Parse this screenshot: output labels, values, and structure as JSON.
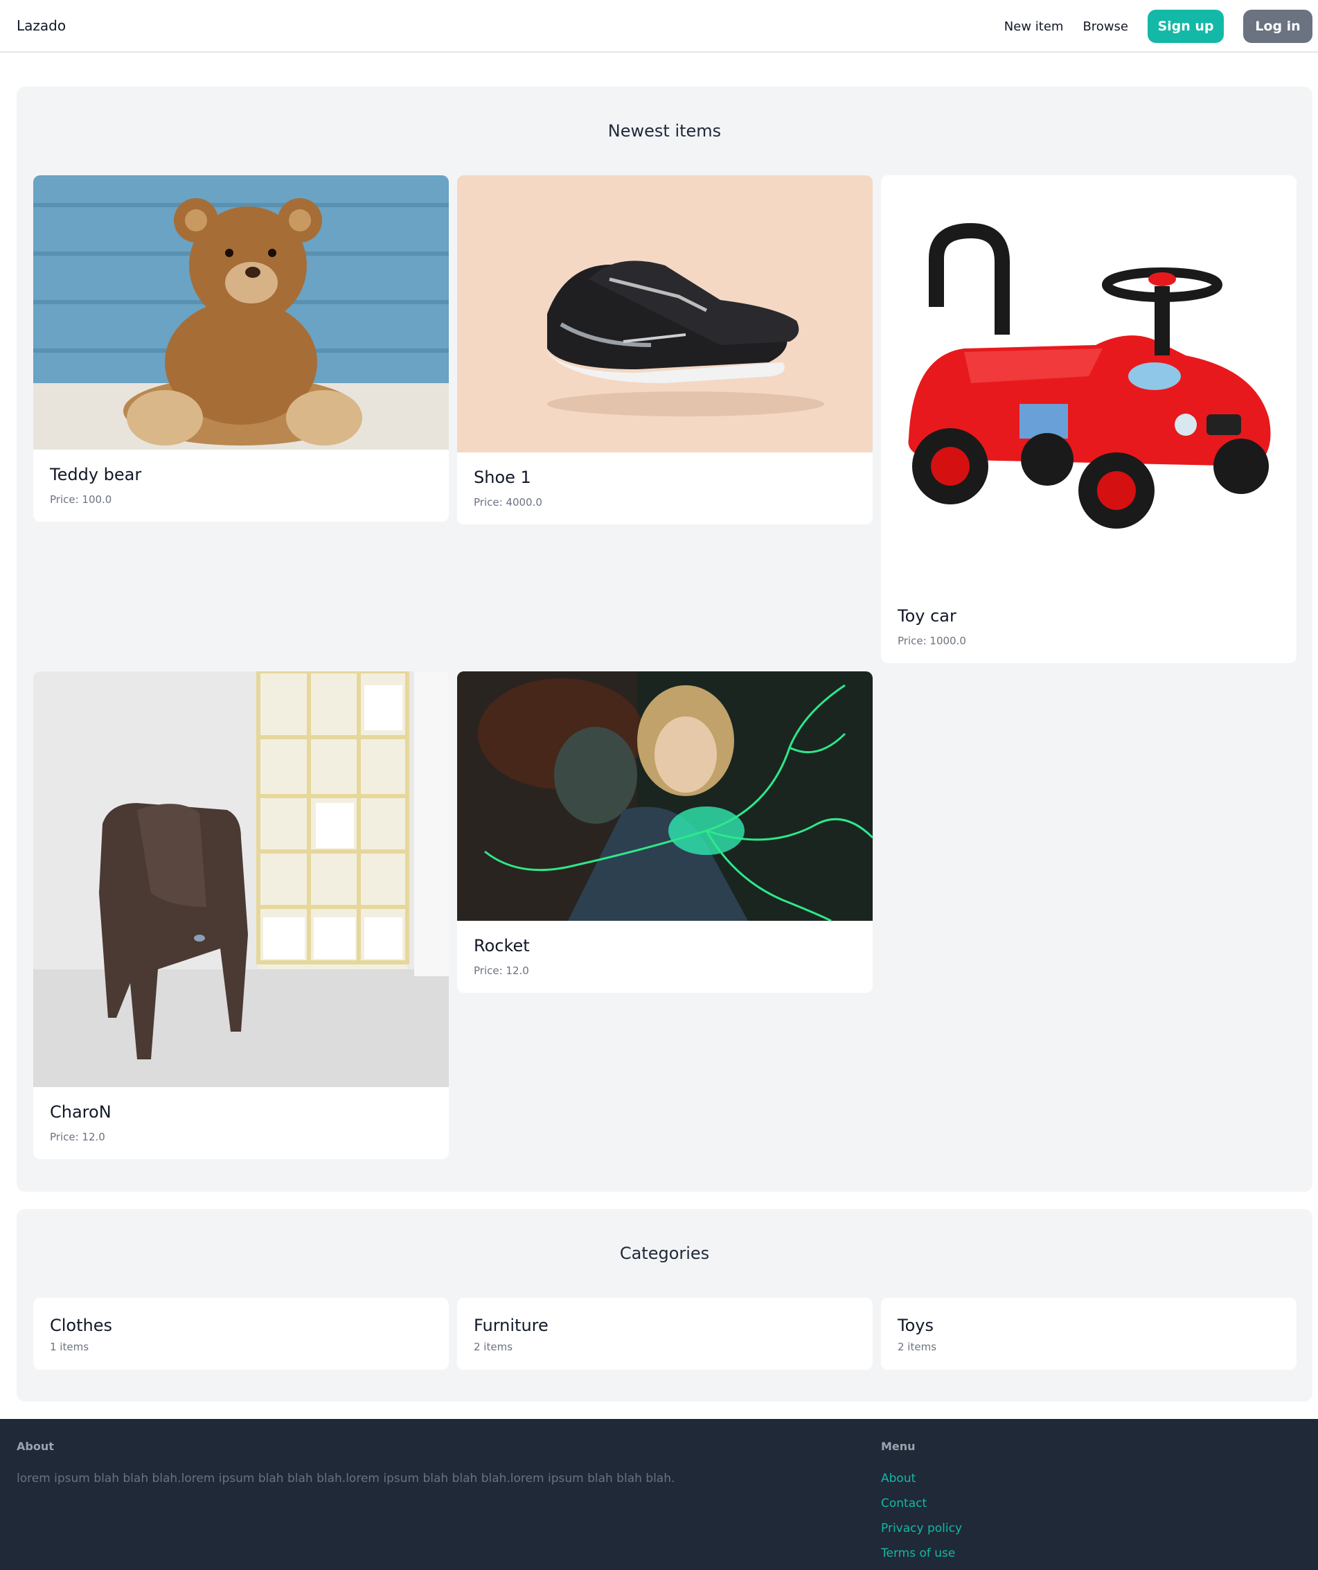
{
  "navbar": {
    "brand": "Lazado",
    "links": {
      "new_item": "New item",
      "browse": "Browse"
    },
    "signup_label": "Sign up",
    "login_label": "Log in"
  },
  "newest": {
    "title": "Newest items",
    "items": [
      {
        "name": "Teddy bear",
        "price": "Price: 100.0",
        "image": "teddy-bear-photo"
      },
      {
        "name": "Shoe 1",
        "price": "Price: 4000.0",
        "image": "running-shoes-photo"
      },
      {
        "name": "Toy car",
        "price": "Price: 1000.0",
        "image": "red-ride-on-toy-car-photo"
      },
      {
        "name": "CharoN",
        "price": "Price: 12.0",
        "image": "brown-plastic-chair-photo"
      },
      {
        "name": "Rocket",
        "price": "Price: 12.0",
        "image": "anime-illustration-green-energy"
      }
    ]
  },
  "categories": {
    "title": "Categories",
    "items": [
      {
        "name": "Clothes",
        "count": "1 items"
      },
      {
        "name": "Furniture",
        "count": "2 items"
      },
      {
        "name": "Toys",
        "count": "2 items"
      }
    ]
  },
  "footer": {
    "about_heading": "About",
    "about_text": "lorem ipsum blah blah blah.lorem ipsum blah blah blah.lorem ipsum blah blah blah.lorem ipsum blah blah blah.",
    "menu_heading": "Menu",
    "menu_links": [
      "About",
      "Contact",
      "Privacy policy",
      "Terms of use"
    ]
  },
  "colors": {
    "accent": "#14b8a6",
    "login_button": "#6b7280",
    "panel_bg": "#f3f4f6",
    "footer_bg": "#1f2937"
  }
}
